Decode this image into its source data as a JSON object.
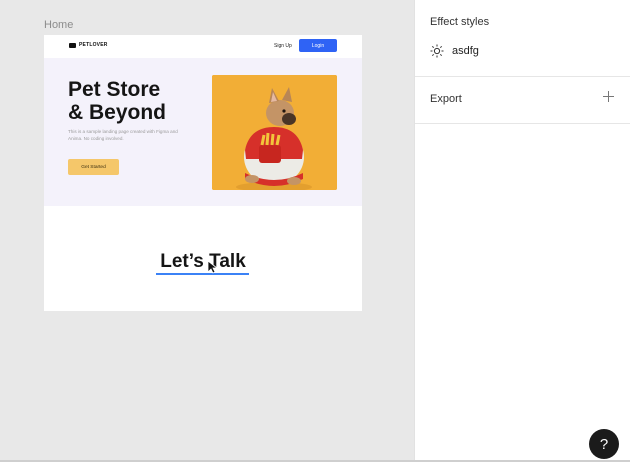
{
  "canvas": {
    "frame_label": "Home",
    "nav": {
      "logo": "PETLOVER",
      "signup": "Sign Up",
      "login": "Login"
    },
    "hero": {
      "title": "Pet Store\n& Beyond",
      "subtitle": "This is a sample landing page created with Figma and Anima. No coding involved.",
      "cta": "Get Started",
      "image_name": "french-bulldog-photo"
    },
    "talk": {
      "title": "Let’s Talk"
    }
  },
  "panel": {
    "effect_styles": {
      "title": "Effect styles",
      "items": [
        {
          "icon": "sun-icon",
          "label": "asdfg"
        }
      ]
    },
    "export": {
      "title": "Export",
      "add_icon": "plus-icon"
    }
  },
  "help": {
    "label": "?"
  },
  "colors": {
    "accent_blue": "#2f63f5",
    "cta_yellow": "#f5c76a",
    "hero_bg": "#f4f2fb",
    "image_bg": "#f2ae36",
    "canvas_bg": "#e8e8e8"
  }
}
